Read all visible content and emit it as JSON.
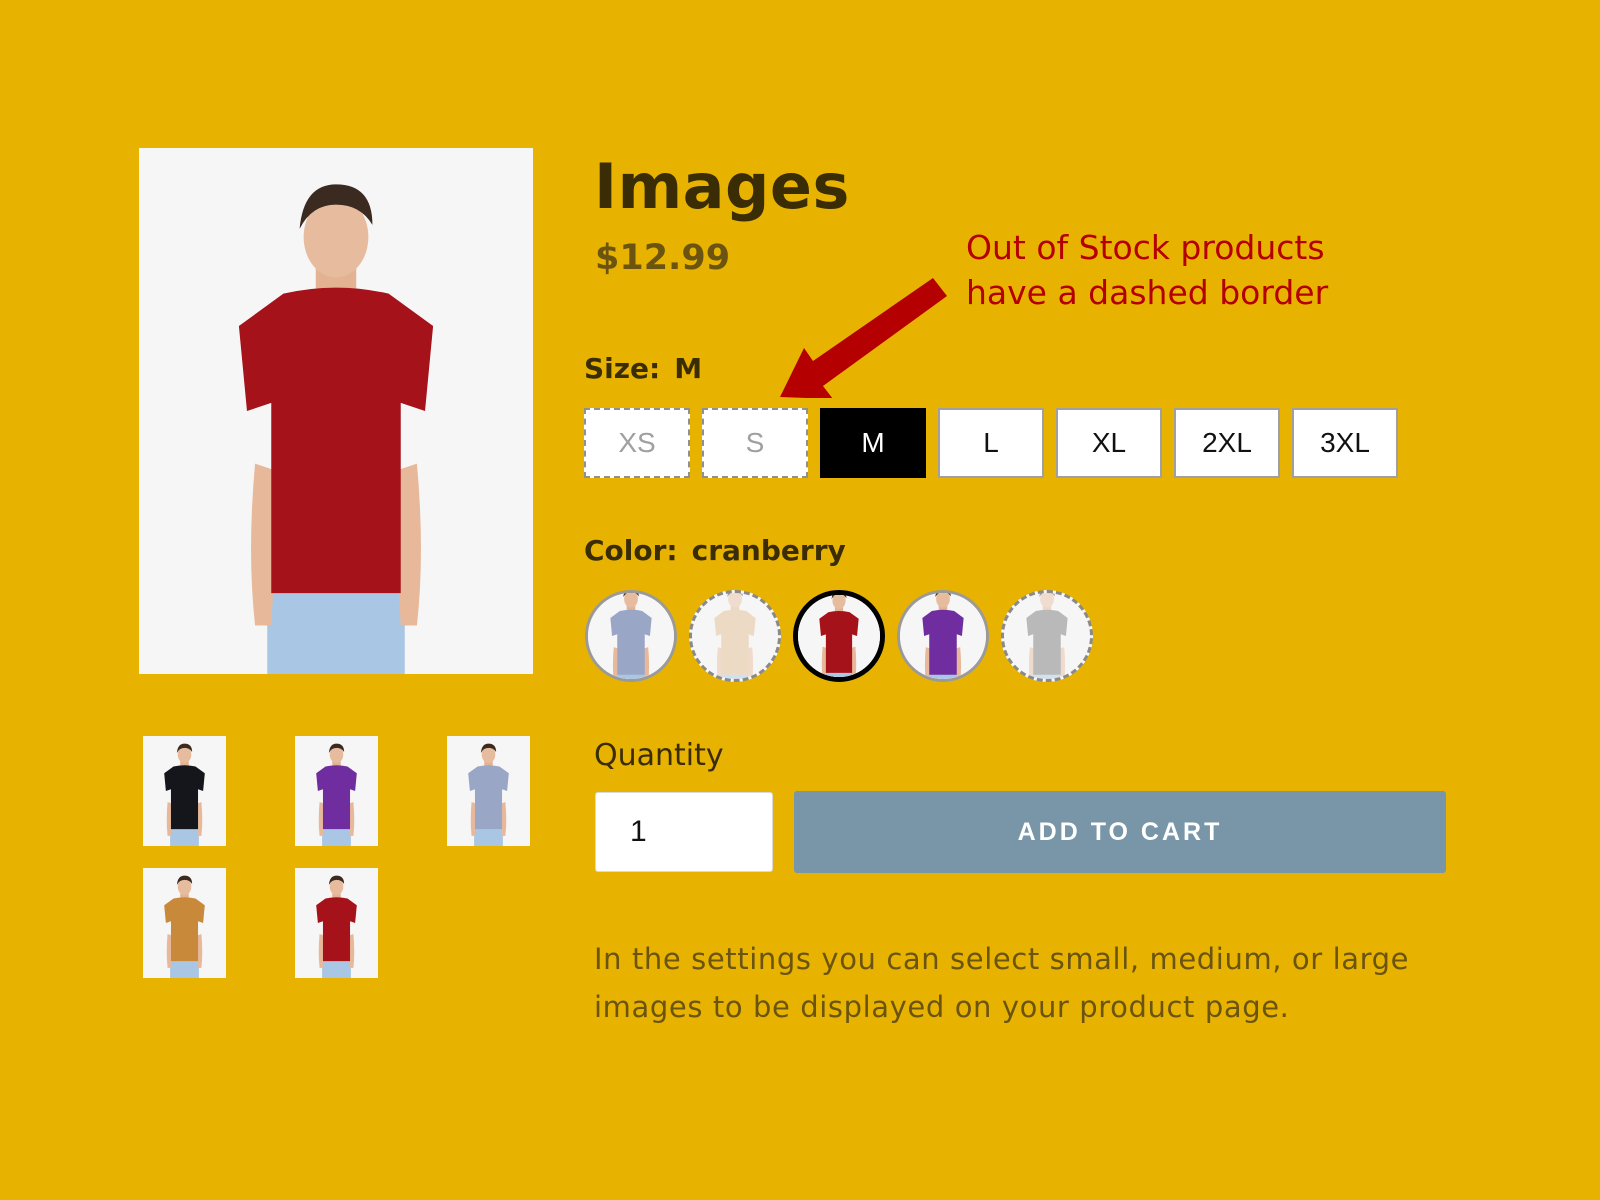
{
  "product": {
    "title": "Images",
    "price": "$12.99",
    "main_image": {
      "alt": "Model wearing cranberry t-shirt",
      "shirt_color": "#a5121a"
    }
  },
  "thumbnails": [
    {
      "alt": "black t-shirt",
      "shirt_color": "#14161c"
    },
    {
      "alt": "purple t-shirt",
      "shirt_color": "#6f2da0"
    },
    {
      "alt": "light blue t-shirt",
      "shirt_color": "#9aa6c6"
    },
    {
      "alt": "tan t-shirt",
      "shirt_color": "#c88a3a"
    },
    {
      "alt": "cranberry t-shirt",
      "shirt_color": "#a5121a"
    }
  ],
  "size": {
    "label": "Size:",
    "selected": "M",
    "options": [
      {
        "label": "XS",
        "state": "out-of-stock"
      },
      {
        "label": "S",
        "state": "out-of-stock"
      },
      {
        "label": "M",
        "state": "selected"
      },
      {
        "label": "L",
        "state": "available"
      },
      {
        "label": "XL",
        "state": "available"
      },
      {
        "label": "2XL",
        "state": "available"
      },
      {
        "label": "3XL",
        "state": "available"
      }
    ]
  },
  "color": {
    "label": "Color:",
    "selected": "cranberry",
    "options": [
      {
        "name": "light blue",
        "shirt_color": "#9aa6c6",
        "state": "available"
      },
      {
        "name": "tan",
        "shirt_color": "#e2b98a",
        "state": "out-of-stock"
      },
      {
        "name": "cranberry",
        "shirt_color": "#a5121a",
        "state": "selected"
      },
      {
        "name": "purple",
        "shirt_color": "#6f2da0",
        "state": "available"
      },
      {
        "name": "grey",
        "shirt_color": "#6f6f6f",
        "state": "out-of-stock"
      }
    ]
  },
  "quantity": {
    "label": "Quantity",
    "value": "1"
  },
  "cart": {
    "button_label": "ADD TO CART",
    "button_color": "#7896a8"
  },
  "description": "In the settings you can select small, medium, or large images to be displayed on your product page.",
  "annotation": {
    "line1": "Out of Stock products",
    "line2": "have a dashed border",
    "color": "#b40000"
  },
  "theme": {
    "background": "#e8b300"
  }
}
